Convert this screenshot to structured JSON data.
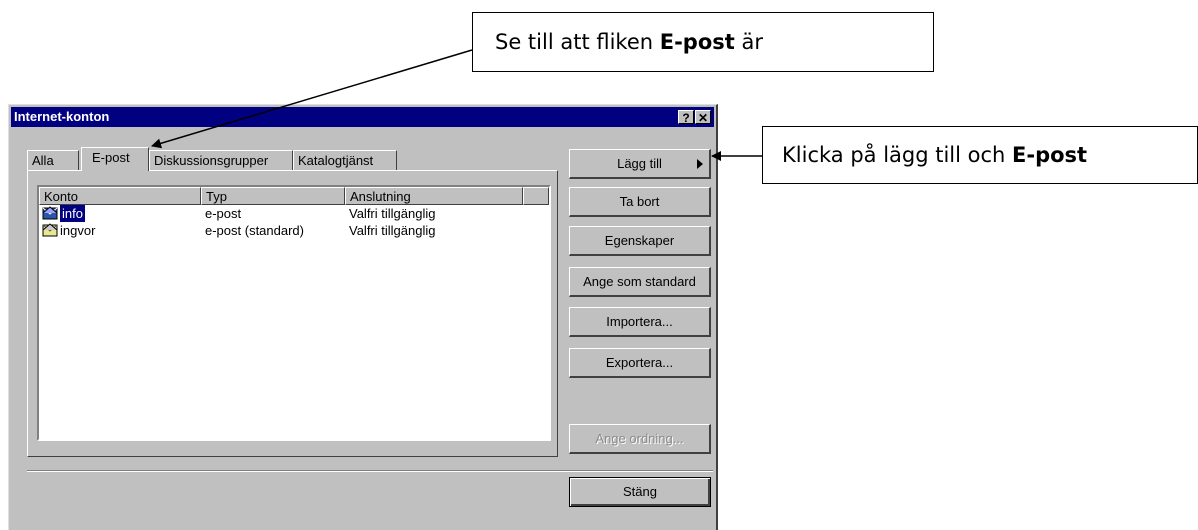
{
  "callouts": {
    "top": {
      "prefix": "Se till att fliken ",
      "bold": "E-post",
      "suffix": " är"
    },
    "right": {
      "prefix": "Klicka på lägg till och ",
      "bold": "E-post"
    }
  },
  "dialog": {
    "title": "Internet-konton",
    "help_label": "?",
    "close_label": "✕",
    "tabs": [
      {
        "label": "Alla"
      },
      {
        "label": "E-post",
        "active": true
      },
      {
        "label": "Diskussionsgrupper"
      },
      {
        "label": "Katalogtjänst"
      }
    ],
    "columns": [
      "Konto",
      "Typ",
      "Anslutning"
    ],
    "rows": [
      {
        "konto": "info",
        "typ": "e-post",
        "anslutning": "Valfri tillgänglig",
        "selected": true
      },
      {
        "konto": "ingvor",
        "typ": "e-post (standard)",
        "anslutning": "Valfri tillgänglig",
        "selected": false
      }
    ],
    "buttons": {
      "add": "Lägg till",
      "remove": "Ta bort",
      "properties": "Egenskaper",
      "set_default": "Ange som standard",
      "import": "Importera...",
      "export": "Exportera...",
      "set_order": "Ange ordning...",
      "close": "Stäng"
    }
  }
}
